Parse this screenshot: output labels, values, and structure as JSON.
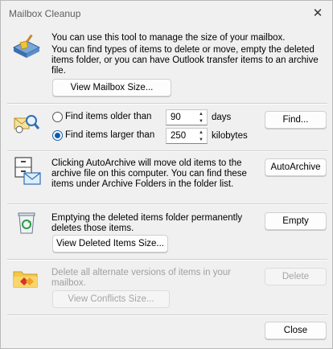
{
  "window": {
    "title": "Mailbox Cleanup",
    "close_glyph": "✕"
  },
  "mailbox_size": {
    "line1": "You can use this tool to manage the size of your mailbox.",
    "line2": "You can find types of items to delete or move, empty the deleted items folder, or you can have Outlook transfer items to an archive file.",
    "button": "View Mailbox Size...",
    "icon": "broom-mailbox-icon"
  },
  "find": {
    "older_label": "Find items older than",
    "older_value": "90",
    "older_unit": "days",
    "larger_label": "Find items larger than",
    "larger_value": "250",
    "larger_unit": "kilobytes",
    "selected": "larger",
    "button": "Find...",
    "icon": "find-items-icon"
  },
  "autoarchive": {
    "text": "Clicking AutoArchive will move old items to the archive file on this computer. You can find these items under Archive Folders in the folder list.",
    "button": "AutoArchive",
    "icon": "archive-cabinet-icon"
  },
  "deleted": {
    "text": "Emptying the deleted items folder permanently deletes those items.",
    "empty_button": "Empty",
    "view_button": "View Deleted Items Size...",
    "icon": "recycle-bin-icon"
  },
  "conflicts": {
    "text": "Delete all alternate versions of items in your mailbox.",
    "delete_button": "Delete",
    "view_button": "View Conflicts Size...",
    "icon": "conflict-folder-icon"
  },
  "footer": {
    "close_button": "Close"
  }
}
